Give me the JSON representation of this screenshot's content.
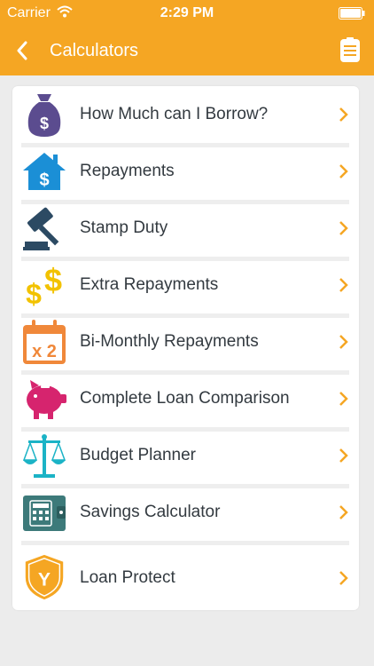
{
  "status_bar": {
    "carrier": "Carrier",
    "time": "2:29 PM"
  },
  "nav": {
    "title": "Calculators"
  },
  "colors": {
    "header": "#f5a623",
    "chevron": "#f5a623"
  },
  "items": [
    {
      "label": "How Much can I Borrow?",
      "icon": "money-bag-icon",
      "color": "#5b4c8f"
    },
    {
      "label": "Repayments",
      "icon": "house-dollar-icon",
      "color": "#1b8fd6"
    },
    {
      "label": "Stamp Duty",
      "icon": "gavel-icon",
      "color": "#2c4a63"
    },
    {
      "label": "Extra Repayments",
      "icon": "dollar-signs-icon",
      "color": "#f2c200"
    },
    {
      "label": "Bi-Monthly Repayments",
      "icon": "calendar-x2-icon",
      "color": "#f0883a",
      "icon_text": "x 2"
    },
    {
      "label": "Complete Loan Comparison",
      "icon": "piggy-bank-icon",
      "color": "#d6246e"
    },
    {
      "label": "Budget Planner",
      "icon": "scales-icon",
      "color": "#1bb3c6"
    },
    {
      "label": "Savings Calculator",
      "icon": "wallet-calculator-icon",
      "color": "#3d7a7a"
    },
    {
      "label": "Loan Protect",
      "icon": "shield-y-icon",
      "color": "#f5a623",
      "icon_text": "Y"
    }
  ]
}
